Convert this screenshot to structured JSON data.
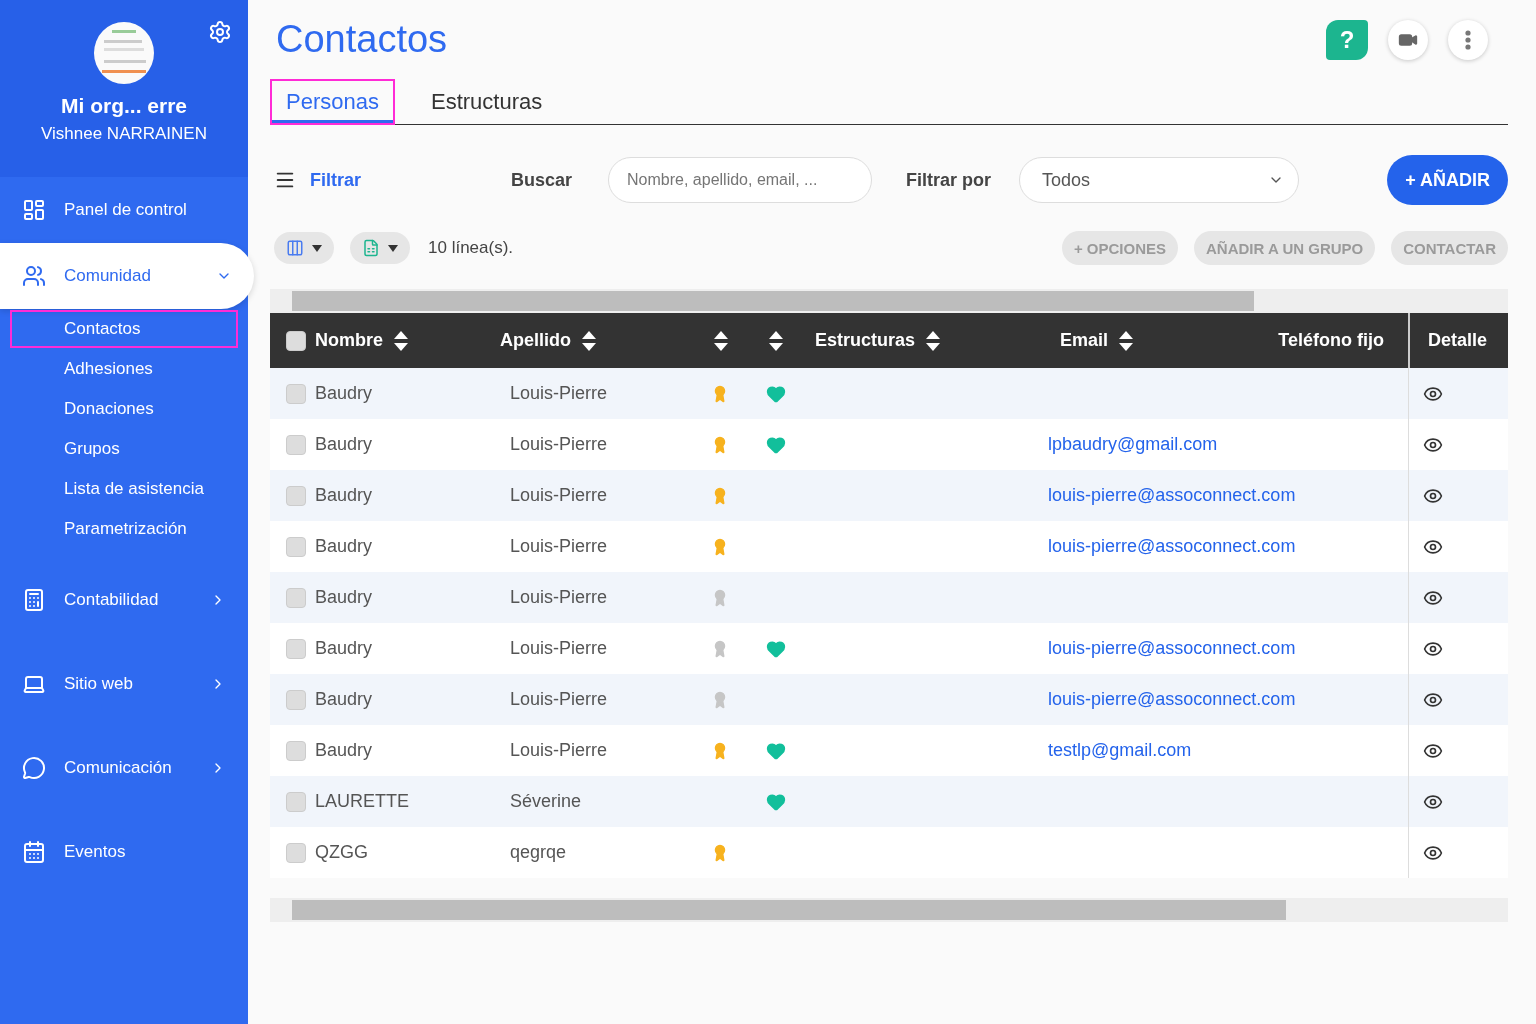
{
  "sidebar": {
    "org_name": "Mi org... erre",
    "user_name": "Vishnee NARRAINEN",
    "items": [
      {
        "label": "Panel de control",
        "selected": false
      },
      {
        "label": "Comunidad",
        "expanded": true,
        "selected": true,
        "children": [
          {
            "label": "Contactos",
            "selected": true
          },
          {
            "label": "Adhesiones",
            "selected": false
          },
          {
            "label": "Donaciones",
            "selected": false
          },
          {
            "label": "Grupos",
            "selected": false
          },
          {
            "label": "Lista de asistencia",
            "selected": false
          },
          {
            "label": "Parametrización",
            "selected": false
          }
        ]
      },
      {
        "label": "Contabilidad",
        "expanded": false,
        "selected": false
      },
      {
        "label": "Sitio web",
        "expanded": false,
        "selected": false
      },
      {
        "label": "Comunicación",
        "expanded": false,
        "selected": false
      },
      {
        "label": "Eventos",
        "selected": false
      }
    ]
  },
  "page_title": "Contactos",
  "help_button": "?",
  "tabs": [
    {
      "label": "Personas",
      "selected": true
    },
    {
      "label": "Estructuras",
      "selected": false
    }
  ],
  "toolbar": {
    "filter_label": "Filtrar",
    "search_label": "Buscar",
    "search": {
      "placeholder": "Nombre, apellido, email, ..."
    },
    "filter_by_label": "Filtrar por",
    "filter_by_value": "Todos",
    "add_button": "+ AÑADIR"
  },
  "line_count": "10 línea(s).",
  "actions": [
    {
      "label": "+ OPCIONES",
      "disabled": true
    },
    {
      "label": "AÑADIR A UN GRUPO",
      "disabled": true
    },
    {
      "label": "CONTACTAR",
      "disabled": true
    }
  ],
  "table": {
    "select_all_checked": false,
    "columns": [
      {
        "label": "Nombre",
        "sortable": true
      },
      {
        "label": "Apellido",
        "sortable": true
      },
      {
        "sortable": true
      },
      {
        "sortable": true
      },
      {
        "label": "Estructuras",
        "sortable": true
      },
      {
        "label": "Email",
        "sortable": true
      },
      {
        "label": "Teléfono fijo",
        "sortable": false
      },
      {
        "label": "Detalle",
        "sortable": false
      }
    ],
    "rows": [
      {
        "nombre": "Baudry",
        "apellido": "Louis-Pierre",
        "medal": true,
        "medal_active": true,
        "favorite": true,
        "checked": false
      },
      {
        "nombre": "Baudry",
        "apellido": "Louis-Pierre",
        "medal": true,
        "medal_active": true,
        "favorite": true,
        "email": "lpbaudry@gmail.com",
        "checked": false
      },
      {
        "nombre": "Baudry",
        "apellido": "Louis-Pierre",
        "medal": true,
        "medal_active": true,
        "favorite": false,
        "email": "louis-pierre@assoconnect.com",
        "checked": false
      },
      {
        "nombre": "Baudry",
        "apellido": "Louis-Pierre",
        "medal": true,
        "medal_active": true,
        "favorite": false,
        "email": "louis-pierre@assoconnect.com",
        "checked": false
      },
      {
        "nombre": "Baudry",
        "apellido": "Louis-Pierre",
        "medal": true,
        "medal_active": false,
        "favorite": false,
        "checked": false
      },
      {
        "nombre": "Baudry",
        "apellido": "Louis-Pierre",
        "medal": true,
        "medal_active": false,
        "favorite": true,
        "email": "louis-pierre@assoconnect.com",
        "checked": false
      },
      {
        "nombre": "Baudry",
        "apellido": "Louis-Pierre",
        "medal": true,
        "medal_active": false,
        "favorite": false,
        "email": "louis-pierre@assoconnect.com",
        "checked": false
      },
      {
        "nombre": "Baudry",
        "apellido": "Louis-Pierre",
        "medal": true,
        "medal_active": true,
        "favorite": true,
        "email": "testlp@gmail.com",
        "checked": false
      },
      {
        "nombre": "LAURETTE",
        "apellido": "Séverine",
        "medal": false,
        "favorite": true,
        "checked": false
      },
      {
        "nombre": "QZGG",
        "apellido": "qegrqe",
        "medal": true,
        "medal_active": true,
        "favorite": false,
        "checked": false
      }
    ]
  }
}
